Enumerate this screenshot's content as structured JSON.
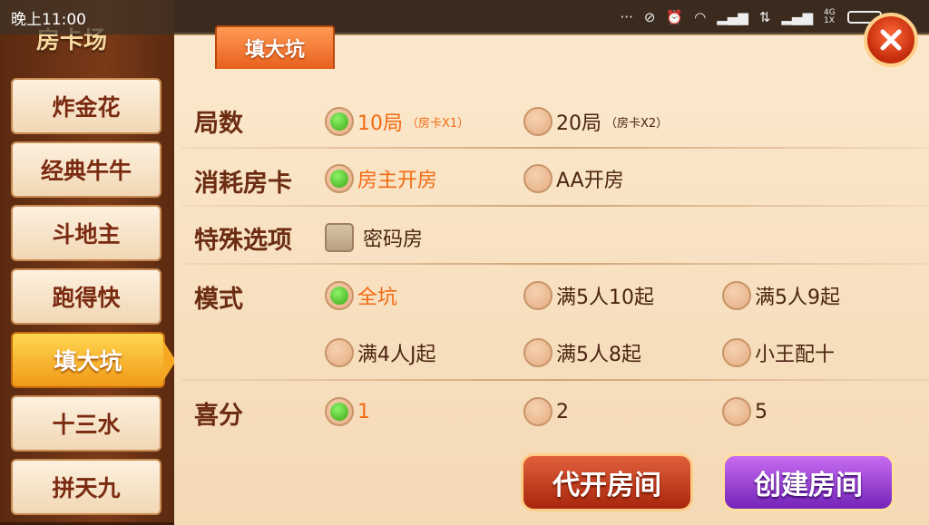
{
  "status_bar": {
    "time": "晚上11:00",
    "network_label": "4G 1X"
  },
  "sidebar": {
    "title": "房卡场",
    "items": [
      {
        "label": "炸金花"
      },
      {
        "label": "经典牛牛"
      },
      {
        "label": "斗地主"
      },
      {
        "label": "跑得快"
      },
      {
        "label": "填大坑",
        "active": true
      },
      {
        "label": "十三水"
      },
      {
        "label": "拼天九"
      }
    ]
  },
  "tab": {
    "label": "填大坑"
  },
  "settings": {
    "rounds": {
      "label": "局数",
      "options": [
        {
          "label": "10局",
          "sub": "（房卡X1）",
          "checked": true
        },
        {
          "label": "20局",
          "sub": "（房卡X2）",
          "checked": false
        }
      ]
    },
    "card_cost": {
      "label": "消耗房卡",
      "options": [
        {
          "label": "房主开房",
          "checked": true
        },
        {
          "label": "AA开房",
          "checked": false
        }
      ]
    },
    "special": {
      "label": "特殊选项",
      "options": [
        {
          "label": "密码房",
          "checked": false
        }
      ]
    },
    "mode": {
      "label": "模式",
      "options": [
        {
          "label": "全坑",
          "checked": true
        },
        {
          "label": "满5人10起",
          "checked": false
        },
        {
          "label": "满5人9起",
          "checked": false
        },
        {
          "label": "满4人J起",
          "checked": false
        },
        {
          "label": "满5人8起",
          "checked": false
        },
        {
          "label": "小王配十",
          "checked": false
        }
      ]
    },
    "bonus": {
      "label": "喜分",
      "options": [
        {
          "label": "1",
          "checked": true
        },
        {
          "label": "2",
          "checked": false
        },
        {
          "label": "5",
          "checked": false
        }
      ]
    }
  },
  "buttons": {
    "proxy_open": "代开房间",
    "create_room": "创建房间"
  },
  "colors": {
    "selected_text": "#f36b15",
    "radio_checked": "#3aa814",
    "active_tab": "#e8601e"
  }
}
